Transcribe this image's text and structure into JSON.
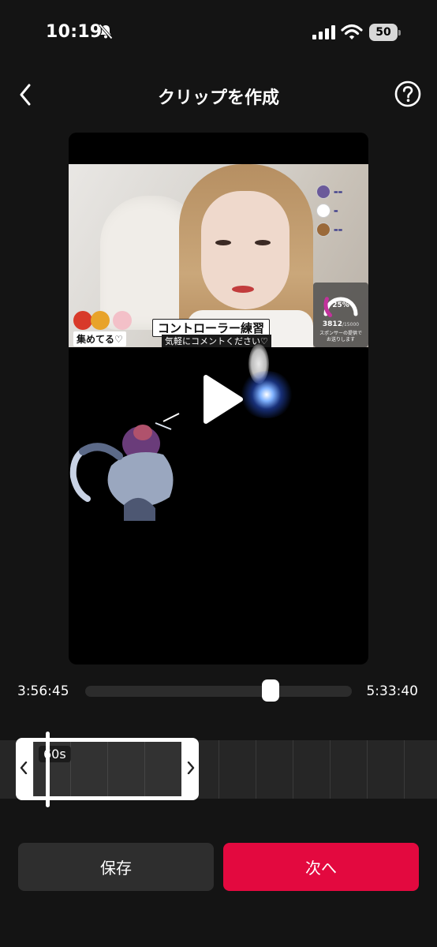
{
  "status_bar": {
    "time": "10:19",
    "battery_level": "50",
    "icons": [
      "bell-slash-icon",
      "signal-icon",
      "wifi-icon",
      "battery-icon"
    ]
  },
  "nav": {
    "title": "クリップを作成",
    "back_icon": "chevron-left-icon",
    "help_icon": "question-circle-icon"
  },
  "video": {
    "overlay": {
      "collect_label": "集めてる♡",
      "controller_label": "コントローラー練習",
      "comment_label": "気軽にコメントください♡",
      "gauge_percent": "25%",
      "gauge_count": "3812",
      "gauge_total": "/15000",
      "gauge_note_line1": "スポンサーの提供で",
      "gauge_note_line2": "お送りします",
      "gauge_fill": 0.25
    },
    "play_icon": "play-icon"
  },
  "scrubber": {
    "start_time": "3:56:45",
    "end_time": "5:33:40",
    "position_fraction": 0.71
  },
  "clip": {
    "duration_label": "60s"
  },
  "actions": {
    "save_label": "保存",
    "next_label": "次へ"
  },
  "colors": {
    "background": "#141414",
    "accent": "#e3093f",
    "secondary_button": "#2e2e2e"
  }
}
